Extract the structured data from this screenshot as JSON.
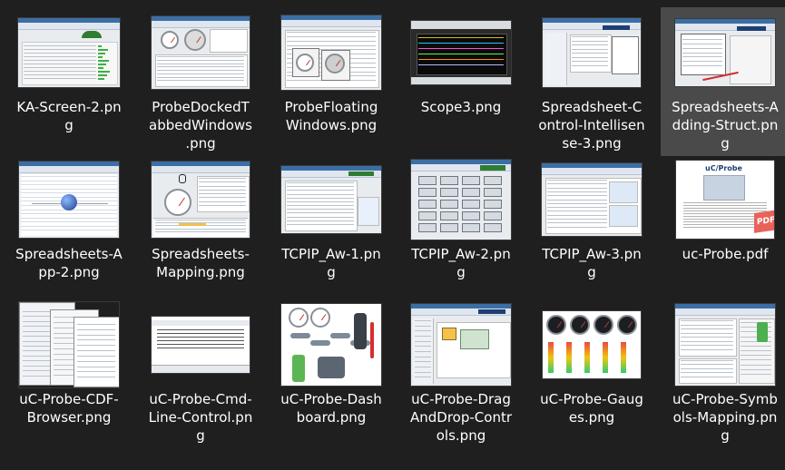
{
  "files": [
    {
      "name": "KA-Screen-2.png",
      "lines": [
        "KA-Screen-2.pn",
        "g"
      ],
      "kind": "ka"
    },
    {
      "name": "ProbeDockedTabbedWindows.png",
      "lines": [
        "ProbeDockedT",
        "abbedWindows",
        ".png"
      ],
      "kind": "docked"
    },
    {
      "name": "ProbeFloatingWindows.png",
      "lines": [
        "ProbeFloating",
        "Windows.png"
      ],
      "kind": "floating"
    },
    {
      "name": "Scope3.png",
      "lines": [
        "Scope3.png"
      ],
      "kind": "scope"
    },
    {
      "name": "Spreadsheet-Control-Intellisense-3.png",
      "lines": [
        "Spreadsheet-C",
        "ontrol-Intellisen",
        "se-3.png"
      ],
      "kind": "sheetctl"
    },
    {
      "name": "Spreadsheets-Adding-Struct.png",
      "lines": [
        "Spreadsheets-A",
        "dding-Struct.pn",
        "g"
      ],
      "kind": "addstruct",
      "selected": true
    },
    {
      "name": "Spreadsheets-App-2.png",
      "lines": [
        "Spreadsheets-A",
        "pp-2.png"
      ],
      "kind": "app2"
    },
    {
      "name": "Spreadsheets-Mapping.png",
      "lines": [
        "Spreadsheets-",
        "Mapping.png"
      ],
      "kind": "mapping"
    },
    {
      "name": "TCPIP_Aw-1.png",
      "lines": [
        "TCPIP_Aw-1.pn",
        "g"
      ],
      "kind": "tcp1"
    },
    {
      "name": "TCPIP_Aw-2.png",
      "lines": [
        "TCPIP_Aw-2.pn",
        "g"
      ],
      "kind": "tcp2"
    },
    {
      "name": "TCPIP_Aw-3.png",
      "lines": [
        "TCPIP_Aw-3.pn",
        "g"
      ],
      "kind": "tcp3"
    },
    {
      "name": "uc-Probe.pdf",
      "lines": [
        "uc-Probe.pdf"
      ],
      "kind": "pdf",
      "badge": "PDF",
      "doc_title": "uC/Probe"
    },
    {
      "name": "uC-Probe-CDF-Browser.png",
      "lines": [
        "uC-Probe-CDF-",
        "Browser.png"
      ],
      "kind": "cdf"
    },
    {
      "name": "uC-Probe-Cmd-Line-Control.png",
      "lines": [
        "uC-Probe-Cmd-",
        "Line-Control.pn",
        "g"
      ],
      "kind": "cmd"
    },
    {
      "name": "uC-Probe-Dashboard.png",
      "lines": [
        "uC-Probe-Dash",
        "board.png"
      ],
      "kind": "dash"
    },
    {
      "name": "uC-Probe-DragAndDrop-Controls.png",
      "lines": [
        "uC-Probe-Drag",
        "AndDrop-Contr",
        "ols.png"
      ],
      "kind": "dnd"
    },
    {
      "name": "uC-Probe-Gauges.png",
      "lines": [
        "uC-Probe-Gaug",
        "es.png"
      ],
      "kind": "gauges"
    },
    {
      "name": "uC-Probe-Symbols-Mapping.png",
      "lines": [
        "uC-Probe-Symb",
        "ols-Mapping.pn",
        "g"
      ],
      "kind": "symbols"
    }
  ],
  "colors": {
    "background": "#1f1f1f",
    "selected": "#4a4a4a",
    "text": "#ffffff",
    "pdf_badge": "#e8625a"
  }
}
